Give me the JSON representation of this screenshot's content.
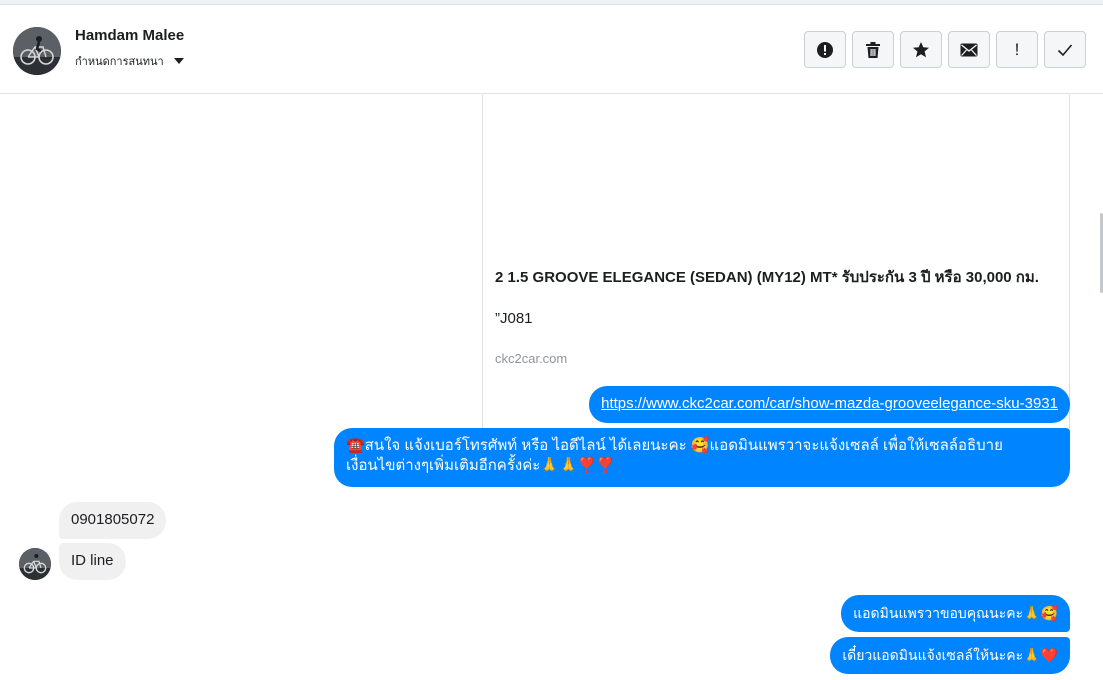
{
  "contact": {
    "name": "Hamdam Malee",
    "assign_label": "กำหนดการสนทนา"
  },
  "actions": [
    {
      "name": "spam",
      "icon": "alert-circle-icon"
    },
    {
      "name": "delete",
      "icon": "trash-icon"
    },
    {
      "name": "star",
      "icon": "star-icon"
    },
    {
      "name": "mark-unread",
      "icon": "envelope-icon"
    },
    {
      "name": "follow-up",
      "icon": "exclamation-icon",
      "glyph": "!"
    },
    {
      "name": "done",
      "icon": "checkmark-icon"
    }
  ],
  "link_card": {
    "title": "2 1.5 GROOVE ELEGANCE (SEDAN) (MY12) MT* รับประกัน 3 ปี หรือ 30,000 กม.",
    "description": "”J081",
    "domain": "ckc2car.com"
  },
  "messages": {
    "link": "https://www.ckc2car.com/car/show-mazda-grooveelegance-sku-3931",
    "long_line1": "☎️สนใจ แจ้งเบอร์โทรศัพท์ หรือ ไอดีไลน์  ได้เลยนะคะ 🥰แอดมินแพรวาจะแจ้งเซลล์     เพื่อให้เซลล์อธิบาย",
    "long_line2": "เงื่อนไขต่างๆเพิ่มเติมอีกครั้งค่ะ🙏🙏❣️❣️",
    "phone": "0901805072",
    "idline": "ID line",
    "thanks": "แอดมินแพรวาขอบคุณนะคะ🙏🥰",
    "notify": "เดี๋ยวแอดมินแจ้งเซลล์ให้นะคะ🙏❤️"
  },
  "colors": {
    "outgoing": "#0084ff",
    "incoming": "#f1f0f0",
    "border": "#dddfe2"
  }
}
